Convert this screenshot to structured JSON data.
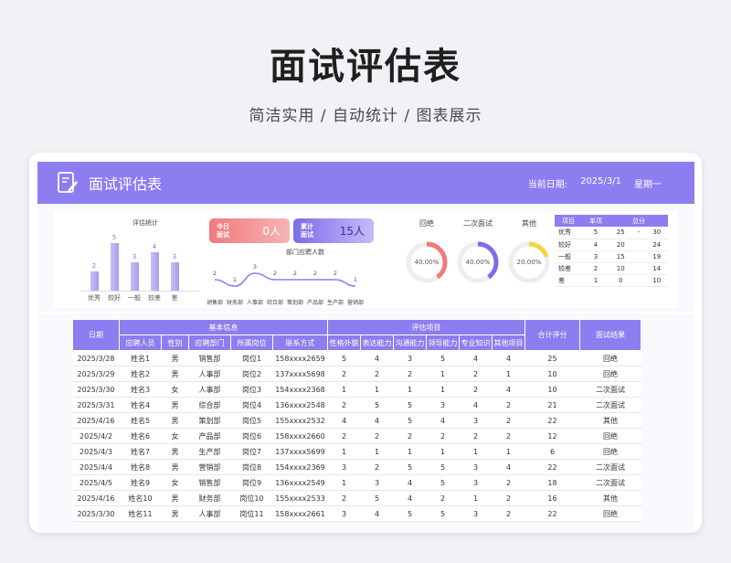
{
  "hero": {
    "title": "面试评估表",
    "subtitle": "简洁实用 / 自动统计 / 图表展示"
  },
  "header": {
    "title": "面试评估表",
    "date_label": "当前日期:",
    "date_value": "2025/3/1",
    "weekday": "星期一"
  },
  "colors": {
    "accent": "#8c7ef0",
    "red": "#f07a7e",
    "yellow": "#f5d44a"
  },
  "eval_chart": {
    "title": "评估统计",
    "categories": [
      "优秀",
      "较好",
      "一般",
      "较差",
      "差"
    ],
    "values": [
      2,
      5,
      3,
      4,
      3
    ]
  },
  "cards": {
    "today": {
      "label_line1": "今日",
      "label_line2": "面试",
      "value": "0人"
    },
    "total": {
      "label_line1": "累计",
      "label_line2": "面试",
      "value": "15人"
    }
  },
  "dept_chart": {
    "title": "部门应聘人数",
    "categories": [
      "销售部",
      "财务部",
      "人事部",
      "综合部",
      "策划部",
      "产品部",
      "生产部",
      "营销部"
    ],
    "values": [
      2,
      1,
      3,
      2,
      2,
      2,
      2,
      1
    ]
  },
  "donuts": [
    {
      "label": "回绝",
      "value": 0.4,
      "text": "40.00%",
      "color": "#f07a7e"
    },
    {
      "label": "二次面试",
      "value": 0.4,
      "text": "40.00%",
      "color": "#7c6cea"
    },
    {
      "label": "其他",
      "value": 0.2,
      "text": "20.00%",
      "color": "#f5d44a"
    }
  ],
  "summary": {
    "headers": [
      "项目",
      "单项",
      "总分"
    ],
    "rows": [
      [
        "优秀",
        "5",
        "25",
        "-",
        "30"
      ],
      [
        "较好",
        "4",
        "20",
        "",
        "24"
      ],
      [
        "一般",
        "3",
        "15",
        "",
        "19"
      ],
      [
        "较差",
        "2",
        "10",
        "",
        "14"
      ],
      [
        "差",
        "1",
        "0",
        "",
        "10"
      ]
    ]
  },
  "table": {
    "h_date": "日期",
    "h_basic": "基本信息",
    "h_eval": "评估项目",
    "h_total": "合计评分",
    "h_result": "面试结果",
    "sub_basic": [
      "应聘人员",
      "性别",
      "应聘部门",
      "所属岗位",
      "联系方式"
    ],
    "sub_eval": [
      "性格外貌",
      "表达能力",
      "沟通能力",
      "领导能力",
      "专业知识",
      "其他项目"
    ],
    "rows": [
      [
        "2025/3/28",
        "姓名1",
        "男",
        "销售部",
        "岗位1",
        "158xxxx2659",
        "5",
        "4",
        "3",
        "5",
        "4",
        "4",
        "25",
        "回绝"
      ],
      [
        "2025/3/29",
        "姓名2",
        "男",
        "人事部",
        "岗位2",
        "137xxxx5698",
        "2",
        "2",
        "2",
        "1",
        "2",
        "1",
        "10",
        "回绝"
      ],
      [
        "2025/3/30",
        "姓名3",
        "女",
        "人事部",
        "岗位3",
        "154xxxx2368",
        "1",
        "1",
        "1",
        "1",
        "2",
        "4",
        "10",
        "二次面试"
      ],
      [
        "2025/3/31",
        "姓名4",
        "男",
        "综合部",
        "岗位4",
        "136xxxx2548",
        "2",
        "5",
        "5",
        "3",
        "4",
        "2",
        "21",
        "二次面试"
      ],
      [
        "2025/4/16",
        "姓名5",
        "男",
        "策划部",
        "岗位5",
        "155xxxx2532",
        "4",
        "4",
        "5",
        "4",
        "3",
        "2",
        "22",
        "其他"
      ],
      [
        "2025/4/2",
        "姓名6",
        "女",
        "产品部",
        "岗位6",
        "158xxxx2660",
        "2",
        "2",
        "2",
        "2",
        "2",
        "2",
        "12",
        "回绝"
      ],
      [
        "2025/4/3",
        "姓名7",
        "男",
        "生产部",
        "岗位7",
        "137xxxx5699",
        "1",
        "1",
        "1",
        "1",
        "1",
        "1",
        "6",
        "回绝"
      ],
      [
        "2025/4/4",
        "姓名8",
        "男",
        "营销部",
        "岗位8",
        "154xxxx2369",
        "3",
        "2",
        "5",
        "5",
        "3",
        "4",
        "22",
        "二次面试"
      ],
      [
        "2025/4/5",
        "姓名9",
        "女",
        "销售部",
        "岗位9",
        "136xxxx2549",
        "1",
        "3",
        "4",
        "5",
        "3",
        "2",
        "18",
        "二次面试"
      ],
      [
        "2025/4/16",
        "姓名10",
        "男",
        "财务部",
        "岗位10",
        "155xxxx2533",
        "2",
        "5",
        "4",
        "2",
        "1",
        "2",
        "16",
        "其他"
      ],
      [
        "2025/3/30",
        "姓名11",
        "男",
        "人事部",
        "岗位11",
        "158xxxx2661",
        "3",
        "4",
        "5",
        "5",
        "3",
        "2",
        "22",
        "回绝"
      ]
    ]
  }
}
